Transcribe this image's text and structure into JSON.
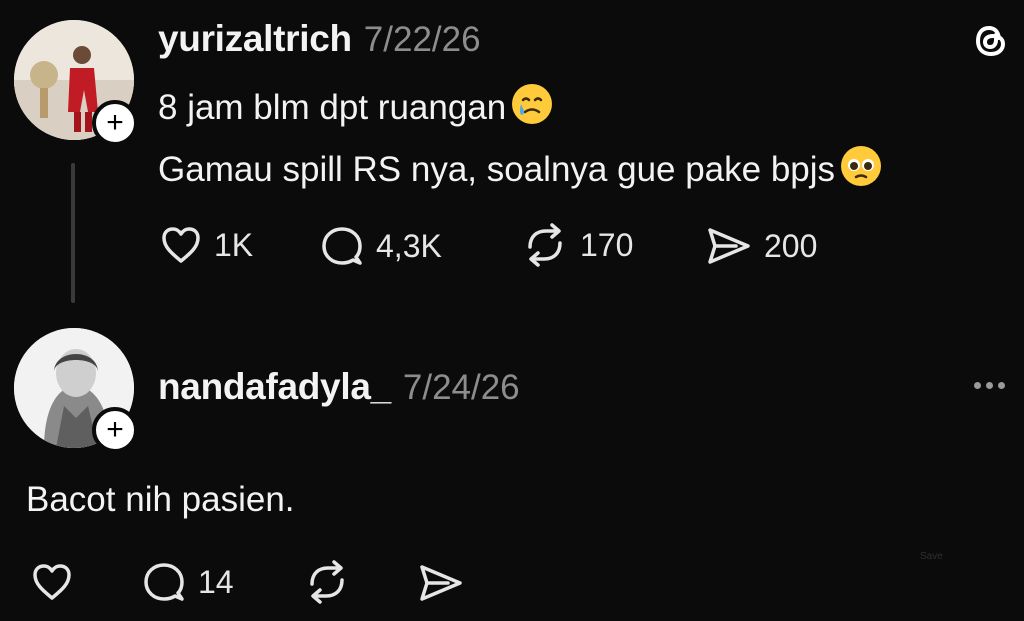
{
  "app": {
    "logo_icon": "threads-logo-icon"
  },
  "posts": [
    {
      "username": "yurizaltrich",
      "date": "7/22/26",
      "lines": [
        "8 jam blm dpt ruangan",
        "Gamau spill RS nya, soalnya gue pake bpjs"
      ],
      "line_emojis": [
        "face-holding-back-tears-icon",
        "pleading-face-icon"
      ],
      "actions": {
        "likes": "1K",
        "replies": "4,3K",
        "reposts": "170",
        "shares": "200"
      }
    },
    {
      "username": "nandafadyla_",
      "date": "7/24/26",
      "text": "Bacot nih pasien.",
      "actions": {
        "likes": "",
        "replies": "14",
        "reposts": "",
        "shares": ""
      },
      "save_label": "Save"
    }
  ],
  "colors": {
    "background": "#0b0b0b",
    "text": "#f3f3f3",
    "muted": "#8d8d8d",
    "thread_line": "#3a3a3a"
  }
}
